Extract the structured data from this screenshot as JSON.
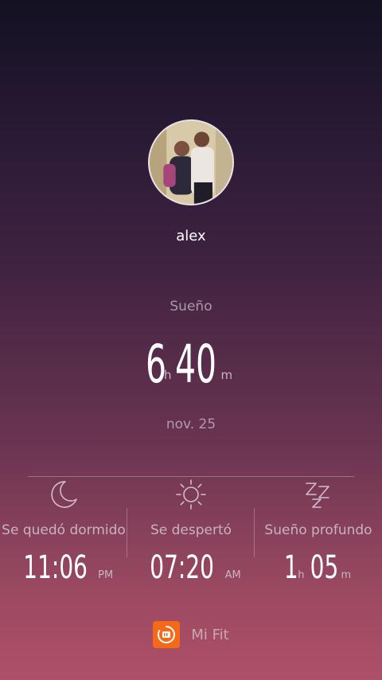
{
  "profile": {
    "name": "alex"
  },
  "metric": {
    "label": "Sueño",
    "hours": "6",
    "hours_unit": "h",
    "minutes": "40",
    "minutes_unit": "m",
    "date": "nov. 25"
  },
  "stats": [
    {
      "icon": "moon-icon",
      "label": "Se quedó dormido",
      "value": "11:06",
      "unit": "PM"
    },
    {
      "icon": "sun-icon",
      "label": "Se despertó",
      "value": "07:20",
      "unit": "AM"
    },
    {
      "icon": "zzz-icon",
      "label": "Sueño profundo",
      "value_h": "1",
      "unit_h": "h",
      "value_m": "05",
      "unit_m": "m"
    }
  ],
  "brand": {
    "name": "Mi Fit",
    "logo_color": "#f46a19"
  }
}
